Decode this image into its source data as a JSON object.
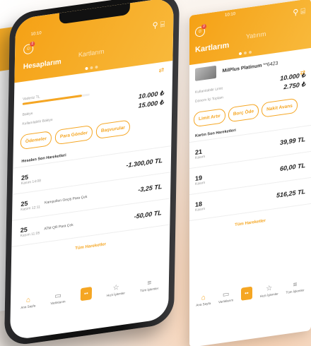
{
  "phone": {
    "status_time": "10:10",
    "title": "Hesaplarım",
    "tab2": "Kartlarım",
    "badge": "2",
    "account_label": "Vadesiz TL",
    "progress": 0.88,
    "balance_label": "Bakiye",
    "balance_value": "10.000 ₺",
    "available_label": "Kullanılabilir Bakiye",
    "available_value": "15.000 ₺",
    "buttons": [
      "Ödemeler",
      "Para Gönder",
      "Başvurular"
    ],
    "section_title": "Hesabın Son Hareketleri",
    "transactions": [
      {
        "day": "25",
        "month": "Kasım",
        "time": "14:08",
        "desc": "",
        "amount": "-1.300,00 TL"
      },
      {
        "day": "25",
        "month": "Kasım",
        "time": "12:11",
        "desc": "Karepollen Geçiş Para Çek",
        "amount": "-3,25 TL"
      },
      {
        "day": "25",
        "month": "Kasım",
        "time": "11:05",
        "desc": "ATM QR Para Çek",
        "amount": "-50,00 TL"
      }
    ],
    "all_label": "Tüm Hareketler",
    "tabs": [
      {
        "icon": "home-icon",
        "glyph": "⌂",
        "label": "Ana Sayfa"
      },
      {
        "icon": "wallet-icon",
        "glyph": "▭",
        "label": "Varlıklarım"
      },
      {
        "icon": "face-icon",
        "glyph": "••",
        "label": ""
      },
      {
        "icon": "star-icon",
        "glyph": "☆",
        "label": "Hızlı İşlemler"
      },
      {
        "icon": "menu-icon",
        "glyph": "≡",
        "label": "Tüm İşlemler"
      }
    ]
  },
  "card_screen": {
    "status_time": "10:10",
    "title": "Kartlarım",
    "tab2": "Yatırım",
    "badge": "2",
    "card_name": "MilPlus Platinum",
    "card_number": "**6423",
    "limit_label": "Kullanılabilir Limit",
    "limit_value": "10.000 ₺",
    "period_label": "Dönem İçi Toplam",
    "period_value": "2.750 ₺",
    "buttons": [
      "Limit Artır",
      "Borç Öde",
      "Nakit Avans"
    ],
    "section_title": "Kartın Son Hareketleri",
    "transactions": [
      {
        "day": "21",
        "month": "Kasım",
        "amount": "39,99 TL"
      },
      {
        "day": "19",
        "month": "Kasım",
        "amount": "60,00 TL"
      },
      {
        "day": "18",
        "month": "Kasım",
        "amount": "516,25 TL"
      }
    ],
    "all_label": "Tüm Hareketler",
    "tabs": [
      {
        "icon": "home-icon",
        "glyph": "⌂",
        "label": "Ana Sayfa"
      },
      {
        "icon": "wallet-icon",
        "glyph": "▭",
        "label": "Varlıklarım"
      },
      {
        "icon": "face-icon",
        "glyph": "••",
        "label": ""
      },
      {
        "icon": "star-icon",
        "glyph": "☆",
        "label": "Hızlı İşlemler"
      },
      {
        "icon": "menu-icon",
        "glyph": "≡",
        "label": "Tüm İşlemler"
      }
    ]
  },
  "colors": {
    "accent": "#f5a623",
    "header_start": "#f5a115",
    "header_end": "#f8b93b"
  }
}
